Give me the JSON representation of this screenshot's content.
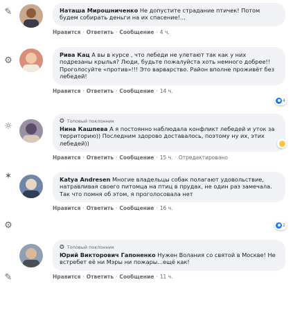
{
  "comments": [
    {
      "author": "Наташа Мирошниченко",
      "text": "Не допустите страдание птичек! Потом будем собирать деньги на их спасение!...",
      "actions": {
        "like": "Нравится",
        "reply": "Ответить",
        "message": "Сообщение",
        "time": "4 ч."
      }
    },
    {
      "author": "Рива Кац",
      "text": "А вы в курсе , что лебеди не улетают так как у них подрезаны крылья? Люди, будьте пожалуйста хоть немного добрее!! Проголосуйте «против»!!! Это варварство. Район вполне проживёт без лебедей!",
      "actions": {
        "like": "Нравится",
        "reply": "Ответить",
        "message": "Сообщение",
        "time": "14 ч."
      },
      "reaction_count": "4"
    },
    {
      "badge": "Топовый поклонник",
      "author": "Нина Кашпева",
      "text": "А я постоянно наблюдала конфликт лебедей и уток за территорию)) Последним здорово доставалось, поэтому ну их, этих лебедей))",
      "actions": {
        "like": "Нравится",
        "reply": "Ответить",
        "message": "Сообщение",
        "time": "15 ч.",
        "edited": "Отредактировано"
      }
    },
    {
      "author": "Katya Andresen",
      "text": "Многие владельцы собак полагают удовольствие, натравливая своего питомца на птиц в прудах, не один раз замечала. Так что помня об этом, я проголосовала нет",
      "actions": {
        "like": "Нравится",
        "reply": "Ответить",
        "message": "Сообщение",
        "time": "16 ч."
      },
      "reaction_count": "2"
    },
    {
      "badge": "Топовый поклонник",
      "author": "Юрий Викторович Гапоненко",
      "text": "Нужен Волания со святой в Москве! Не встребет её ни Мэры ни пожары...ещё как!",
      "actions": {
        "like": "Нравится",
        "reply": "Ответить",
        "message": "Сообщение",
        "time": "11 ч."
      }
    }
  ],
  "colors": {
    "bubble": "#f0f2f5",
    "accent": "#1877f2",
    "meta": "#65676b"
  },
  "icons": [
    "pin-icon",
    "gear-icon",
    "sun-icon",
    "star-icon",
    "gear-icon",
    "pin-icon"
  ]
}
